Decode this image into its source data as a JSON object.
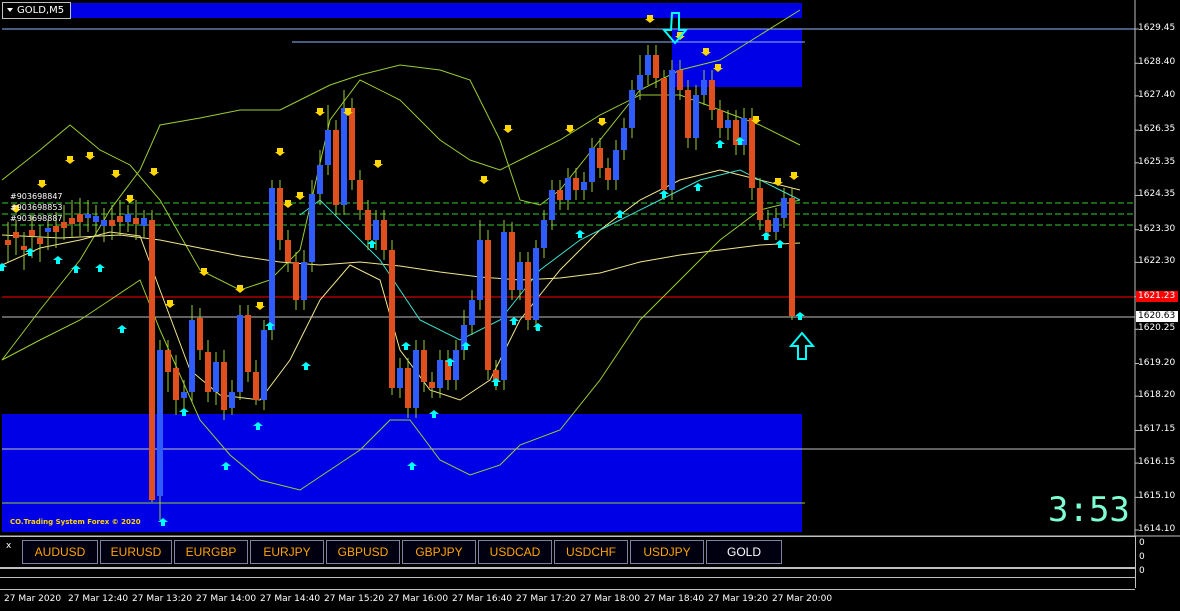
{
  "window": {
    "title": "GOLD,M5"
  },
  "price_axis": [
    "1629.45",
    "1628.40",
    "1627.40",
    "1626.35",
    "1625.35",
    "1624.35",
    "1623.30",
    "1622.30",
    "1621.25",
    "1620.25",
    "1619.20",
    "1618.20",
    "1617.15",
    "1616.15",
    "1615.10",
    "1614.10"
  ],
  "price_tags": {
    "bid": "1621.23",
    "last": "1620.63",
    "bid_color": "#ff0000"
  },
  "time_axis": [
    "27 Mar 2020",
    "27 Mar 12:40",
    "27 Mar 13:20",
    "27 Mar 14:00",
    "27 Mar 14:40",
    "27 Mar 15:20",
    "27 Mar 16:00",
    "27 Mar 16:40",
    "27 Mar 17:20",
    "27 Mar 18:00",
    "27 Mar 18:40",
    "27 Mar 19:20",
    "27 Mar 20:00"
  ],
  "tickets": [
    "#903698847",
    "#903698853",
    "#903698887"
  ],
  "overlay": {
    "copyright": "CO.Trading System Forex © 2020",
    "countdown": "3:53"
  },
  "symbol_bar": {
    "close": "x",
    "symbols": [
      "AUDUSD",
      "EURUSD",
      "EURGBP",
      "EURJPY",
      "GBPUSD",
      "GBPJPY",
      "USDCAD",
      "USDCHF",
      "USDJPY",
      "GOLD"
    ],
    "active": "GOLD",
    "scale_top": "0",
    "scale_mid": "0",
    "scale_bot": "0"
  },
  "colors": {
    "zone": "#0000e6",
    "bull": "#2f5cff",
    "bear": "#e0501e",
    "bands": "#9acd32",
    "ma_slow": "#f0e68c",
    "arrow_down": "#ffd700",
    "arrow_up": "#00ffff"
  }
}
